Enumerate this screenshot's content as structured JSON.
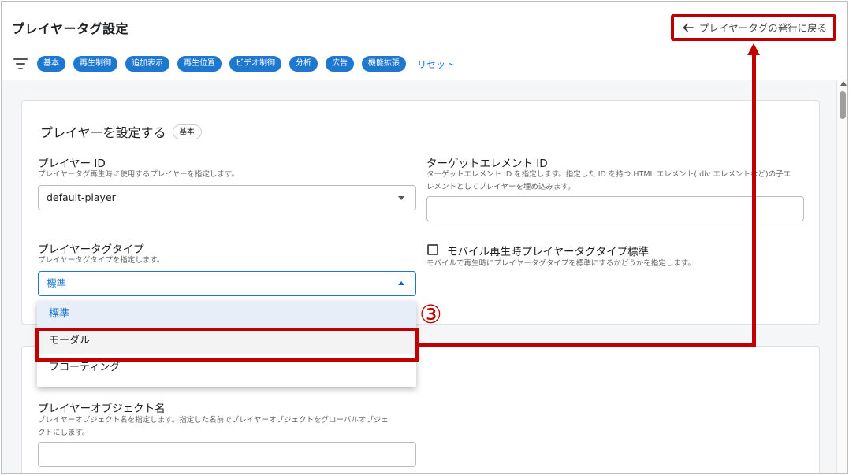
{
  "header": {
    "title": "プレイヤータグ設定",
    "back_label": "プレイヤータグの発行に戻る"
  },
  "filters": {
    "chips": [
      "基本",
      "再生制御",
      "追加表示",
      "再生位置",
      "ビデオ制御",
      "分析",
      "広告",
      "機能拡張"
    ],
    "reset_label": "リセット"
  },
  "section": {
    "title": "プレイヤーを設定する",
    "tag": "基本"
  },
  "player_id": {
    "label": "プレイヤー ID",
    "hint": "プレイヤータグ再生時に使用するプレイヤーを指定します。",
    "value": "default-player"
  },
  "target_element": {
    "label": "ターゲットエレメント ID",
    "hint_line1": "ターゲットエレメント ID を指定します。指定した ID を持つ HTML エレメント( div エレメントなど)の子エ",
    "hint_line2": "レメントとしてプレイヤーを埋め込みます。",
    "value": ""
  },
  "tag_type": {
    "label": "プレイヤータグタイプ",
    "hint": "プレイヤータグタイプを指定します。",
    "value": "標準",
    "options": [
      "標準",
      "モーダル",
      "フローティング"
    ]
  },
  "mobile": {
    "label": "モバイル再生時プレイヤータグタイプ標準",
    "hint": "モバイルで再生時にプレイヤータグタイプを標準にするかどうかを指定します。",
    "checked": false
  },
  "object_name": {
    "label": "プレイヤーオブジェクト名",
    "hint_line1": "プレイヤーオブジェクト名を指定します。指定した名前でプレイヤーオブジェクトをグローバルオブジェ",
    "hint_line2": "クトにします。",
    "value": ""
  },
  "annotation": {
    "step": "③",
    "color": "#c00000"
  },
  "colors": {
    "accent": "#1e78d0",
    "highlight": "#c00000"
  }
}
